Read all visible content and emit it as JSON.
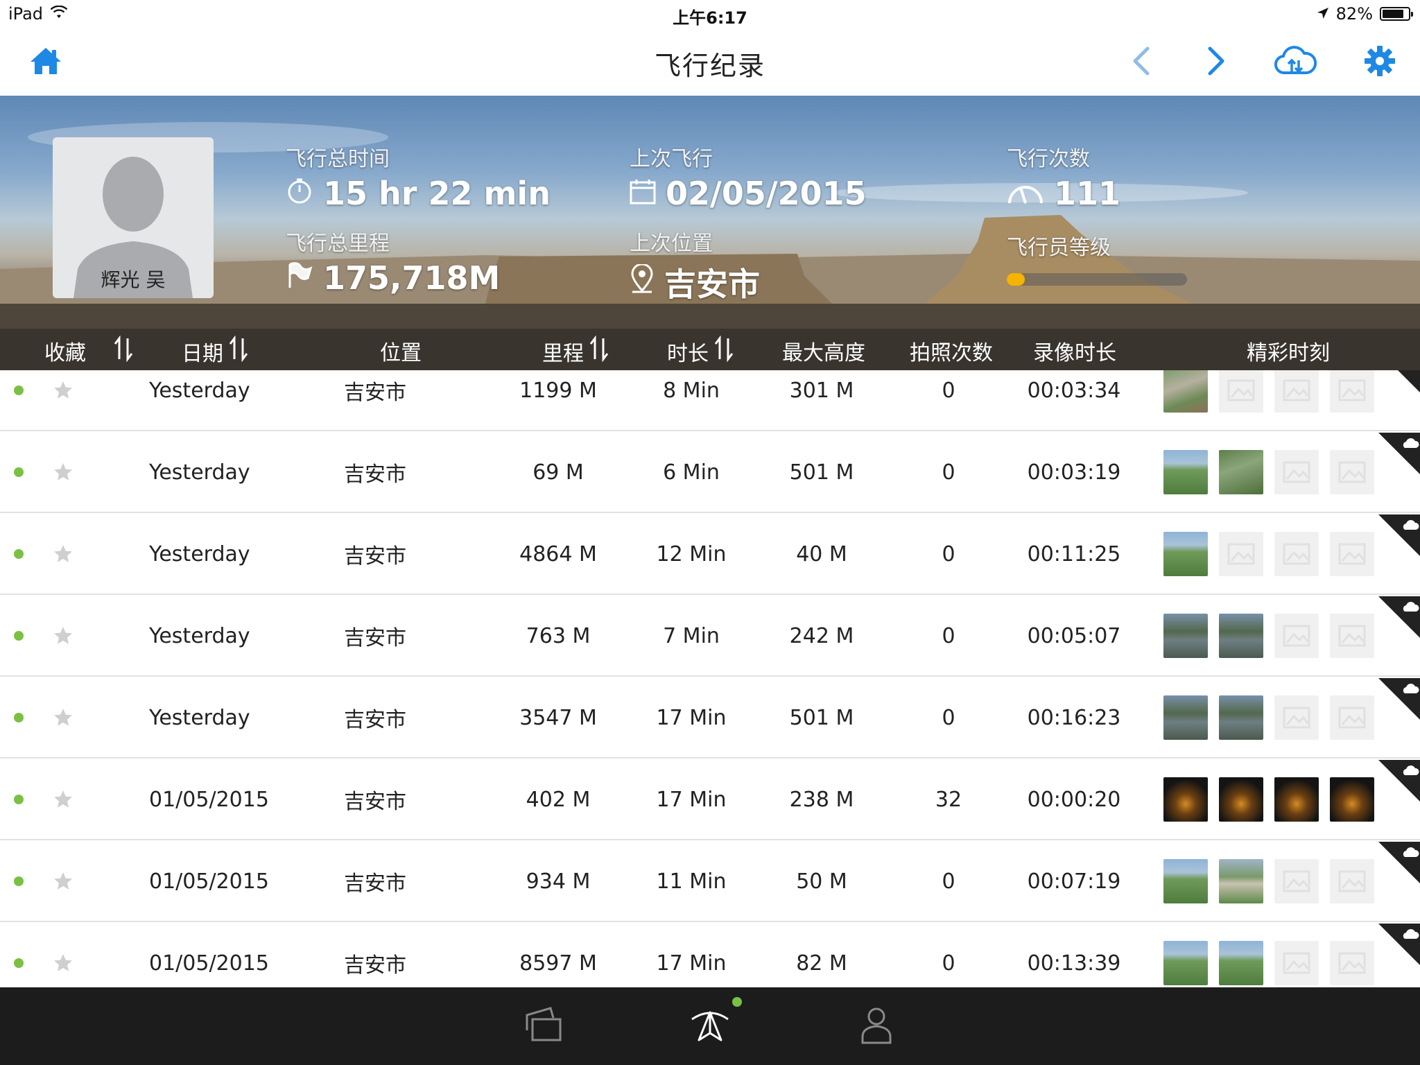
{
  "status_bar": {
    "device": "iPad",
    "time": "上午6:17",
    "battery": "82%",
    "battery_level": 0.82
  },
  "nav": {
    "title": "飞行纪录",
    "icons": [
      "home-icon",
      "chevron-left-icon",
      "chevron-right-icon",
      "cloud-sync-icon",
      "gear-icon"
    ],
    "accent_color": "#1e88e5"
  },
  "profile": {
    "name": "辉光 吴",
    "total_time_label": "飞行总时间",
    "total_time": "15 hr 22 min",
    "last_flight_label": "上次飞行",
    "last_flight": "02/05/2015",
    "flight_count_label": "飞行次数",
    "flight_count": "111",
    "total_distance_label": "飞行总里程",
    "total_distance": "175,718M",
    "last_location_label": "上次位置",
    "last_location": "吉安市",
    "pilot_level_label": "飞行员等级",
    "pilot_level": 0.03
  },
  "table": {
    "headers": {
      "favorite": "收藏",
      "date": "日期",
      "location": "位置",
      "distance": "里程",
      "duration": "时长",
      "max_altitude": "最大高度",
      "photos": "拍照次数",
      "video_length": "录像时长",
      "highlights": "精彩时刻"
    },
    "rows": [
      {
        "date": "Yesterday",
        "location": "吉安市",
        "distance": "1199 M",
        "duration": "8 Min",
        "max_altitude": "301 M",
        "photos": "0",
        "video": "00:03:34",
        "thumbs": [
          "aerial-village",
          "empty",
          "empty",
          "empty"
        ],
        "cloud": true
      },
      {
        "date": "Yesterday",
        "location": "吉安市",
        "distance": "69 M",
        "duration": "6 Min",
        "max_altitude": "501 M",
        "photos": "0",
        "video": "00:03:19",
        "thumbs": [
          "aerial-field",
          "aerial-hills",
          "empty",
          "empty"
        ],
        "cloud": true
      },
      {
        "date": "Yesterday",
        "location": "吉安市",
        "distance": "4864 M",
        "duration": "12 Min",
        "max_altitude": "40 M",
        "photos": "0",
        "video": "00:11:25",
        "thumbs": [
          "aerial-field",
          "empty",
          "empty",
          "empty"
        ],
        "cloud": true
      },
      {
        "date": "Yesterday",
        "location": "吉安市",
        "distance": "763 M",
        "duration": "7 Min",
        "max_altitude": "242 M",
        "photos": "0",
        "video": "00:05:07",
        "thumbs": [
          "aerial-lake",
          "aerial-lake",
          "empty",
          "empty"
        ],
        "cloud": true
      },
      {
        "date": "Yesterday",
        "location": "吉安市",
        "distance": "3547 M",
        "duration": "17 Min",
        "max_altitude": "501 M",
        "photos": "0",
        "video": "00:16:23",
        "thumbs": [
          "aerial-lake",
          "aerial-lake",
          "empty",
          "empty"
        ],
        "cloud": true
      },
      {
        "date": "01/05/2015",
        "location": "吉安市",
        "distance": "402 M",
        "duration": "17 Min",
        "max_altitude": "238 M",
        "photos": "32",
        "video": "00:00:20",
        "thumbs": [
          "night",
          "night",
          "night",
          "night"
        ],
        "cloud": true
      },
      {
        "date": "01/05/2015",
        "location": "吉安市",
        "distance": "934 M",
        "duration": "11 Min",
        "max_altitude": "50 M",
        "photos": "0",
        "video": "00:07:19",
        "thumbs": [
          "aerial-field",
          "aerial-road",
          "empty",
          "empty"
        ],
        "cloud": true
      },
      {
        "date": "01/05/2015",
        "location": "吉安市",
        "distance": "8597 M",
        "duration": "17 Min",
        "max_altitude": "82 M",
        "photos": "0",
        "video": "00:13:39",
        "thumbs": [
          "aerial-field",
          "aerial-field",
          "empty",
          "empty"
        ],
        "cloud": true
      }
    ]
  },
  "tab_bar": {
    "tabs": [
      "cards-icon",
      "aircraft-icon",
      "user-icon"
    ],
    "active": "aircraft-icon",
    "indicator_color": "#7ac143"
  }
}
